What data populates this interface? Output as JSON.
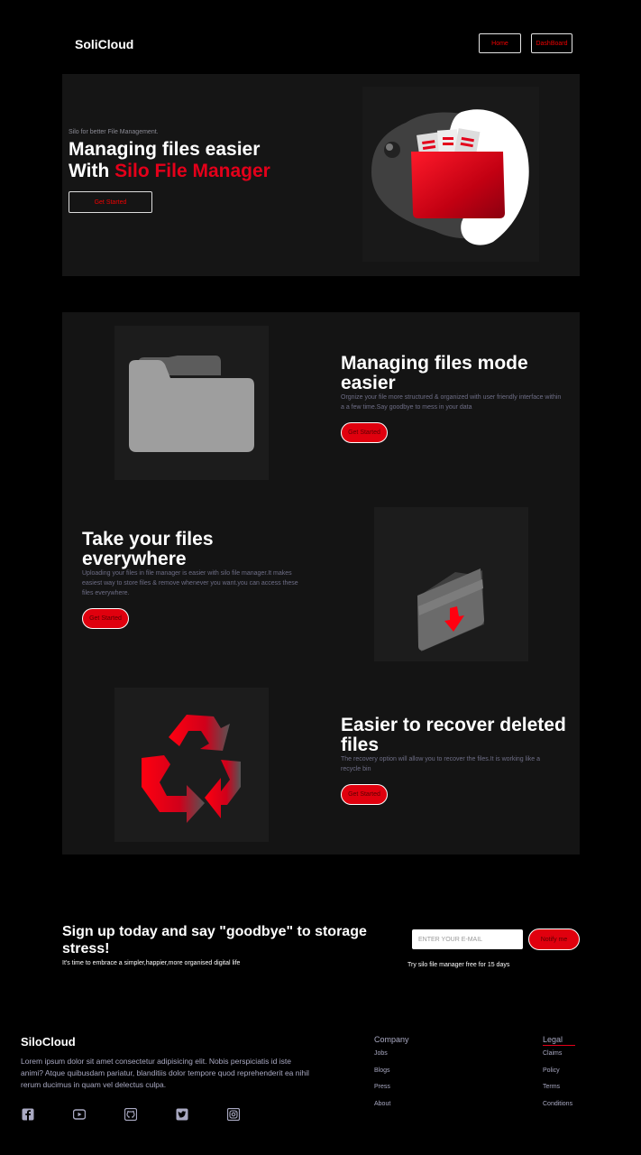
{
  "header": {
    "brand": "SoliCloud",
    "nav": {
      "home": "Home",
      "dashboard": "DashBoard"
    }
  },
  "hero": {
    "tagline": "Silo for better File Management.",
    "title_line1": "Managing files easier",
    "title_prefix": "With ",
    "title_accent": "Silo File Manager",
    "cta": "Get Started"
  },
  "features": [
    {
      "title": "Managing files mode easier",
      "description": "Orgnize your file more structured & organized with user friendly interface within a a few time.Say goodbye to mess in your data",
      "cta": "Get Started",
      "icon": "folder-icon"
    },
    {
      "title": "Take your files everywhere",
      "description": "Uploading your files in file manager is easier with silo file manager.It makes easiest way to store files & remove whenever you want.you can access these files everywhere.",
      "cta": "Get Started",
      "icon": "upload-folder-icon"
    },
    {
      "title": "Easier to recover deleted files",
      "description": "The recovery option will allow you to recover the files.It is working like a recycle bin",
      "cta": "Get Started",
      "icon": "recycle-icon"
    }
  ],
  "signup": {
    "title": "Sign up today and say \"goodbye\" to storage stress!",
    "subtitle": "It's time to embrace a simpler,happier,more organised digital life",
    "email_placeholder": "ENTER YOUR E-MAIL",
    "button": "Notify me",
    "note": "Try silo file manager free for 15 days"
  },
  "footer": {
    "brand": "SiloCloud",
    "text": "Lorem ipsum dolor sit amet consectetur adipisicing elit. Nobis perspiciatis id iste animi? Atque quibusdam pariatur, blanditiis dolor tempore quod reprehenderit ea nihil rerum ducimus in quam vel delectus culpa.",
    "company": {
      "heading": "Company",
      "links": [
        "Jobs",
        "Blogs",
        "Press",
        "About"
      ]
    },
    "legal": {
      "heading": "Legal",
      "links": [
        "Claims",
        "Policy",
        "Terms",
        "Conditions"
      ]
    },
    "social_icons": [
      "facebook-icon",
      "youtube-icon",
      "github-icon",
      "twitter-icon",
      "instagram-icon"
    ]
  },
  "colors": {
    "accent": "#e4001a",
    "panel": "#151515",
    "muted": "#a9a9c2"
  }
}
